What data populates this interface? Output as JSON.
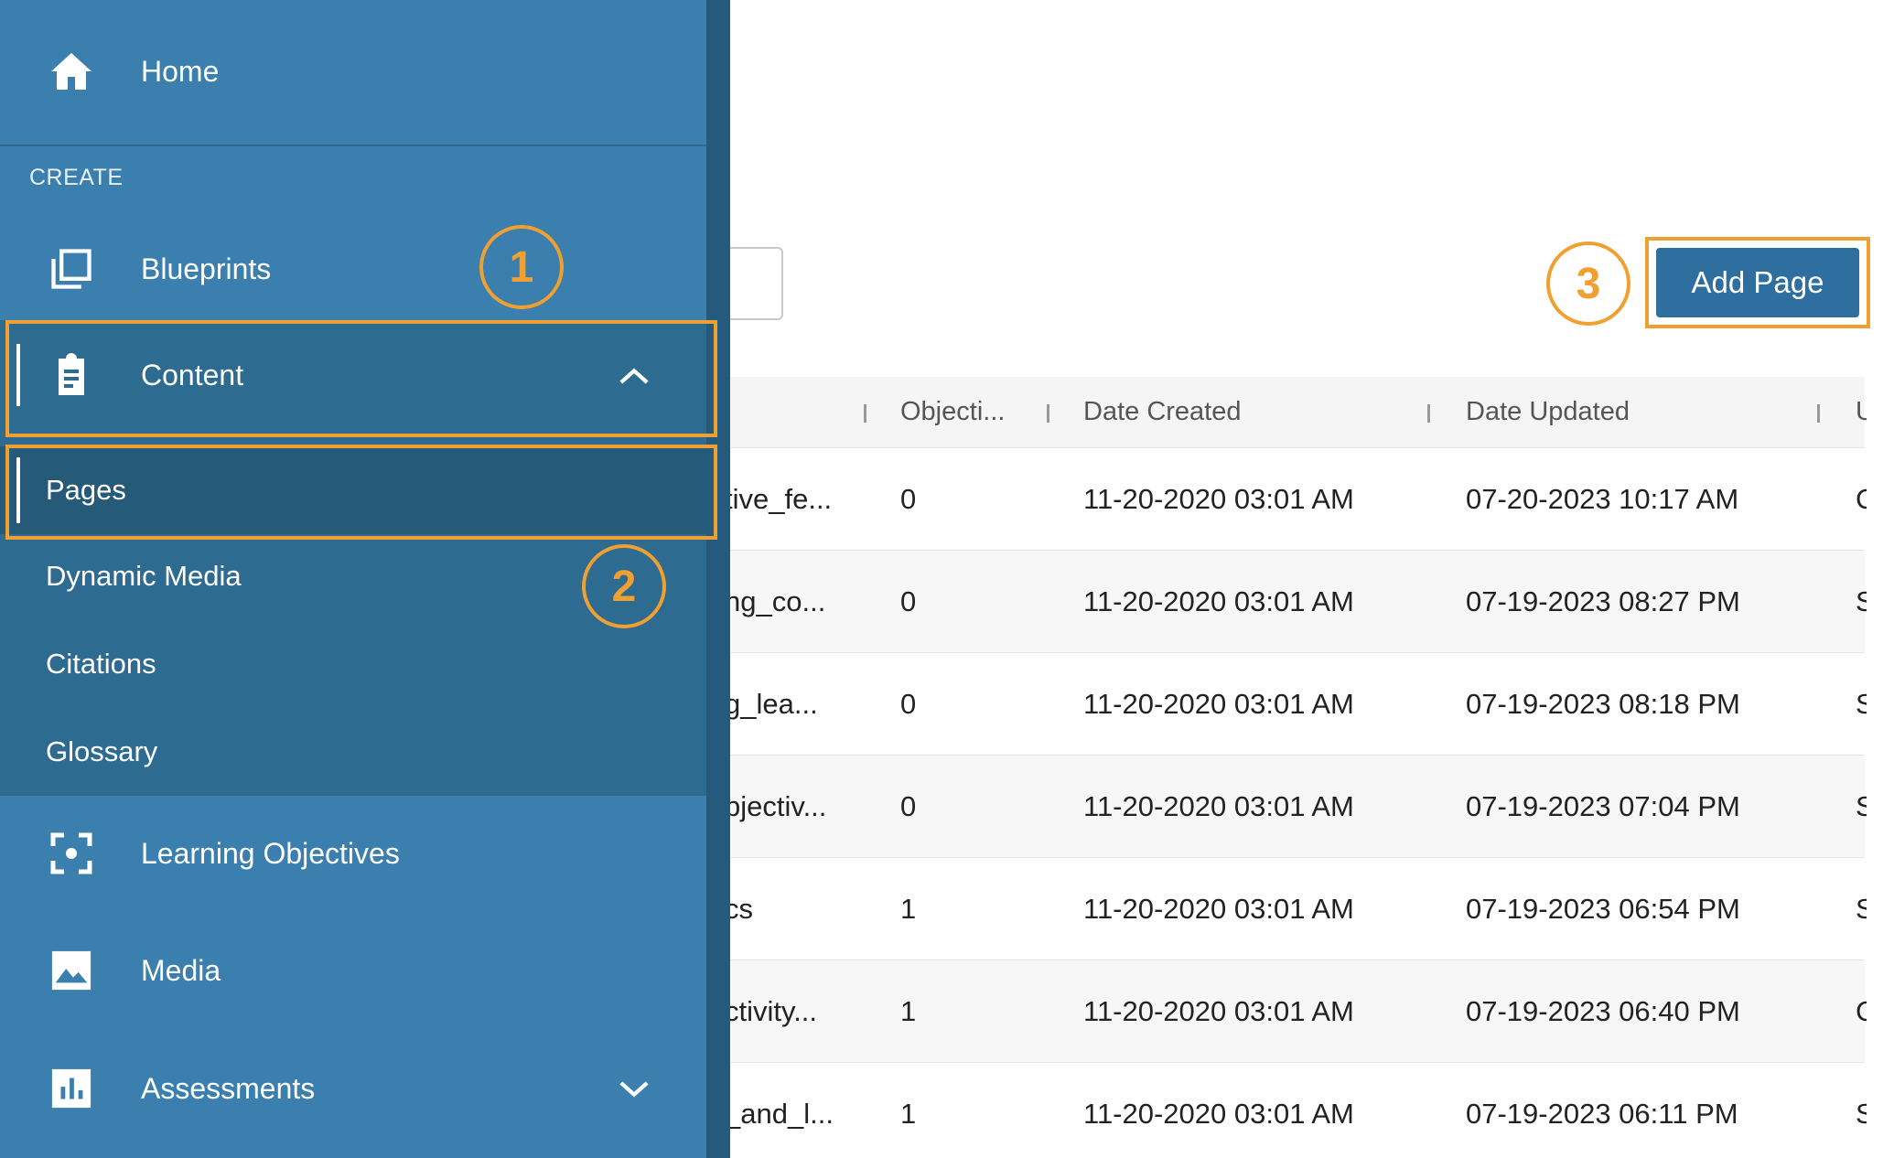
{
  "sidebar": {
    "home_label": "Home",
    "section_create": "CREATE",
    "items": {
      "blueprints": "Blueprints",
      "content": "Content",
      "learning_objectives": "Learning Objectives",
      "media": "Media",
      "assessments": "Assessments"
    },
    "content_subitems": {
      "pages": "Pages",
      "dynamic_media": "Dynamic Media",
      "citations": "Citations",
      "glossary": "Glossary"
    },
    "icons": {
      "home": "home-icon",
      "blueprints": "blueprints-icon",
      "content": "clipboard-icon",
      "learning_objectives": "focus-icon",
      "media": "image-icon",
      "assessments": "bar-chart-icon"
    }
  },
  "toolbar": {
    "add_page_label": "Add Page"
  },
  "callouts": {
    "one": "1",
    "two": "2",
    "three": "3"
  },
  "table": {
    "headers": {
      "objectives": "Objecti...",
      "date_created": "Date Created",
      "date_updated": "Date Updated",
      "last": "U"
    },
    "rows": [
      {
        "title": "tive_fe...",
        "objectives": "0",
        "created": "11-20-2020 03:01 AM",
        "updated": "07-20-2023 10:17 AM",
        "last": "C"
      },
      {
        "title": "ng_co...",
        "objectives": "0",
        "created": "11-20-2020 03:01 AM",
        "updated": "07-19-2023 08:27 PM",
        "last": "S"
      },
      {
        "title": "g_lea...",
        "objectives": "0",
        "created": "11-20-2020 03:01 AM",
        "updated": "07-19-2023 08:18 PM",
        "last": "S"
      },
      {
        "title": "bjectiv...",
        "objectives": "0",
        "created": "11-20-2020 03:01 AM",
        "updated": "07-19-2023 07:04 PM",
        "last": "S"
      },
      {
        "title": "cs",
        "objectives": "1",
        "created": "11-20-2020 03:01 AM",
        "updated": "07-19-2023 06:54 PM",
        "last": "S"
      },
      {
        "title": "ctivity...",
        "objectives": "1",
        "created": "11-20-2020 03:01 AM",
        "updated": "07-19-2023 06:40 PM",
        "last": "C"
      },
      {
        "title": "_and_l...",
        "objectives": "1",
        "created": "11-20-2020 03:01 AM",
        "updated": "07-19-2023 06:11 PM",
        "last": "S"
      }
    ]
  },
  "colors": {
    "sidebar_bg": "#3a7fae",
    "content_group_bg": "#2e6b91",
    "active_bg": "#255a79",
    "accent_orange": "#f0a030",
    "button_blue": "#2f6f9f"
  }
}
